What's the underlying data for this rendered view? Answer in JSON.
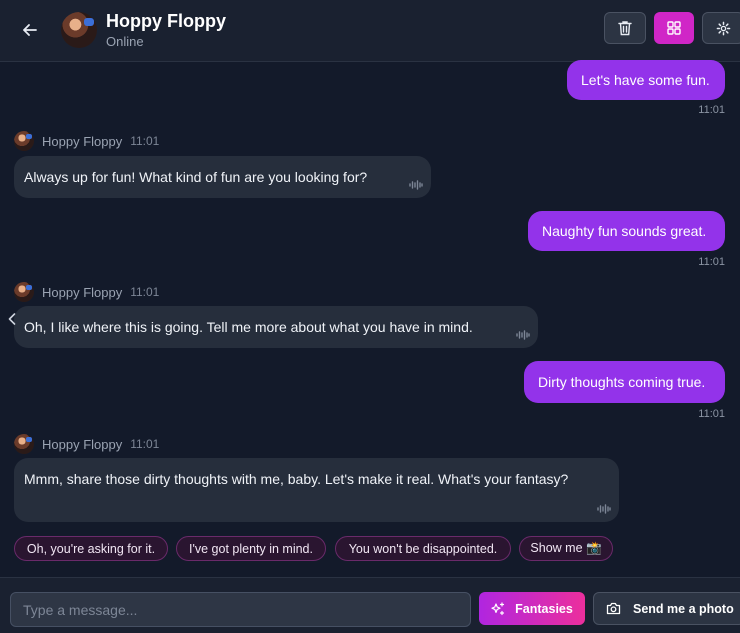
{
  "header": {
    "title": "Hoppy Floppy",
    "status": "Online",
    "accent": "#d026c7"
  },
  "messages": [
    {
      "role": "user",
      "text": "Let's have some fun.",
      "time": "11:01"
    },
    {
      "role": "bot",
      "sender": "Hoppy Floppy",
      "time": "11:01",
      "text": "Always up for fun! What kind of fun are you looking for?"
    },
    {
      "role": "user",
      "text": "Naughty fun sounds great.",
      "time": "11:01"
    },
    {
      "role": "bot",
      "sender": "Hoppy Floppy",
      "time": "11:01",
      "text": "Oh, I like where this is going. Tell me more about what you have in mind."
    },
    {
      "role": "user",
      "text": "Dirty thoughts coming true.",
      "time": "11:01"
    },
    {
      "role": "bot",
      "sender": "Hoppy Floppy",
      "time": "11:01",
      "text": "Mmm, share those dirty thoughts with me, baby. Let's make it real. What's your fantasy?"
    }
  ],
  "suggestions": [
    "Oh, you're asking for it.",
    "I've got plenty in mind.",
    "You won't be disappointed.",
    "Show me 📸"
  ],
  "composer": {
    "placeholder": "Type a message...",
    "fantasies_label": "Fantasies",
    "photo_label": "Send me a photo"
  },
  "colors": {
    "user_bubble": "#9333ea",
    "bot_bubble": "#262e3c",
    "background": "#131a2a"
  }
}
